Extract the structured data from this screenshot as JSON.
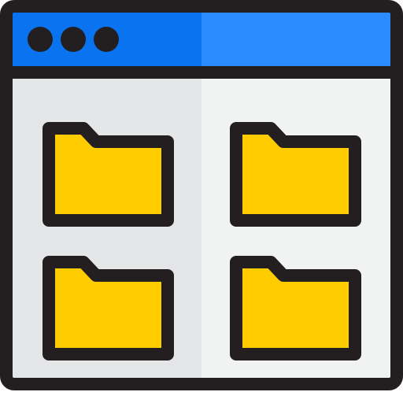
{
  "window": {
    "title_bar": {
      "dots": [
        {
          "icon": "window-control-dot"
        },
        {
          "icon": "window-control-dot"
        },
        {
          "icon": "window-control-dot"
        }
      ],
      "colors": {
        "left": "#0973F0",
        "right": "#2A8BFF"
      }
    },
    "content": {
      "colors": {
        "left": "#E5E6E7",
        "right": "#F1F2F2"
      },
      "folders": [
        {
          "icon": "folder-icon"
        },
        {
          "icon": "folder-icon"
        },
        {
          "icon": "folder-icon"
        },
        {
          "icon": "folder-icon"
        }
      ]
    },
    "colors": {
      "outline": "#231F20",
      "folder": "#FFCC00"
    }
  }
}
